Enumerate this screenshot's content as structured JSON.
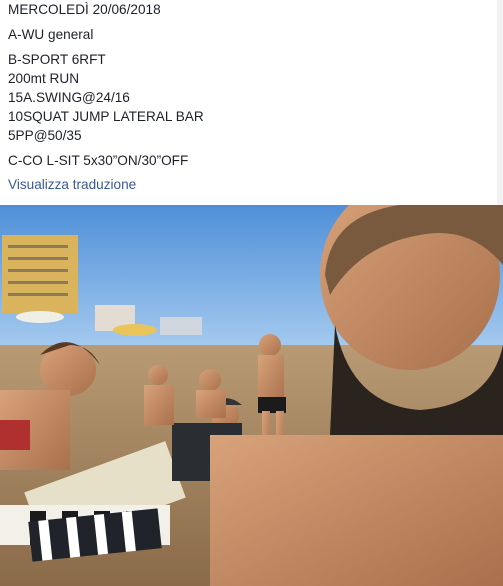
{
  "post": {
    "date": "MERCOLEDÌ 20/06/2018",
    "section_a": "A-WU general",
    "section_b": [
      "B-SPORT 6RFT",
      "200mt RUN",
      "15A.SWING@24/16",
      "10SQUAT JUMP LATERAL BAR",
      "5PP@50/35"
    ],
    "section_c": "C-CO L-SIT 5x30”ON/30”OFF",
    "translate_link": "Visualizza traduzione"
  },
  "photo": {
    "subject": "group-selfie-beach"
  },
  "colors": {
    "link": "#385898",
    "text": "#1d2129",
    "sky": "#6fa8e6",
    "sand": "#c9a57b",
    "sea": "#2f6f9a"
  }
}
